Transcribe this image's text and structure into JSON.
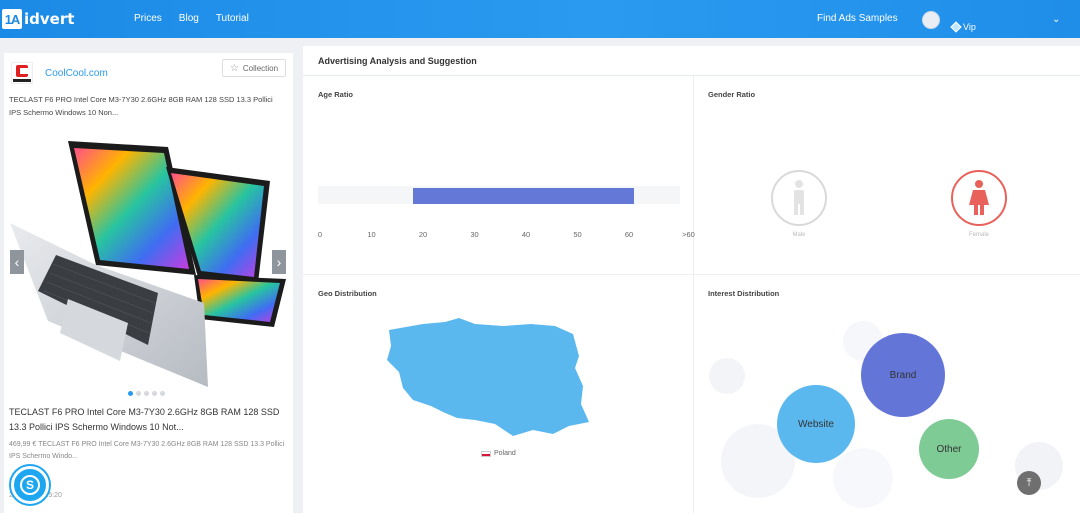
{
  "topbar": {
    "logo_mark": "1A",
    "logo_text": "idvert",
    "nav": [
      "Prices",
      "Blog",
      "Tutorial"
    ],
    "find_ads": "Find Ads Samples",
    "vip": "Vip"
  },
  "ad": {
    "advertiser": "CoolCool.com",
    "collection_label": "Collection",
    "description": "TECLAST F6 PRO Intel Core M3-7Y30 2.6GHz 8GB RAM 128 SSD 13.3 Pollici IPS Schermo Windows 10 Non...",
    "title": "TECLAST F6 PRO Intel Core M3-7Y30 2.6GHz 8GB RAM 128 SSD 13.3 Pollici IPS Schermo Windows 10 Not...",
    "body": "469,99 € TECLAST F6 PRO Intel Core M3-7Y30 2.6GHz 8GB RAM 128 SSD 13.3 Pollici IPS Schermo Windo...",
    "shares": "0",
    "views": "1",
    "date": "2020-2018 15:20",
    "slide_count": 5,
    "active_slide": 1
  },
  "analysis": {
    "title": "Advertising Analysis and Suggestion",
    "age": {
      "title": "Age Ratio",
      "ticks": [
        "0",
        "10",
        "20",
        "30",
        "40",
        "50",
        "60",
        ">60"
      ],
      "range_start": 18,
      "range_end": 61
    },
    "gender": {
      "title": "Gender Ratio",
      "male_label": "Male",
      "female_label": "Female",
      "selected": "female",
      "male_color": "#d9d9d9",
      "female_color": "#e8615a"
    },
    "geo": {
      "title": "Geo Distribution",
      "country": "Poland",
      "map_color": "#5bb8ef"
    },
    "interest": {
      "title": "Interest Distribution",
      "bubbles": [
        {
          "label": "Brand",
          "color": "#6376d8"
        },
        {
          "label": "Website",
          "color": "#5bb8ef"
        },
        {
          "label": "Other",
          "color": "#7ecb95"
        }
      ]
    }
  }
}
